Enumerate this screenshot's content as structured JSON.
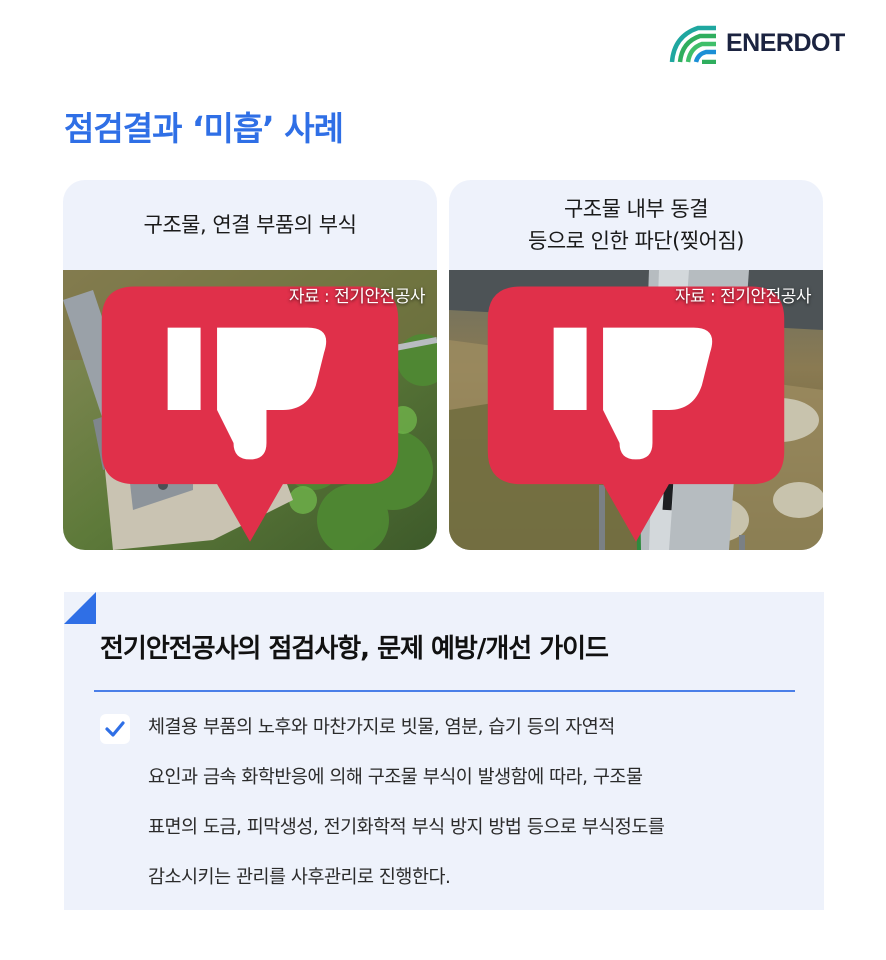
{
  "brand": {
    "name": "ENERDOT",
    "icon": "enerdot-wave-logo"
  },
  "page_title": "점검결과 ‘미흡’ 사례",
  "cards": [
    {
      "title": "구조물, 연결 부품의 부식",
      "badge_icon": "thumbs-down-icon",
      "source": "자료 : 전기안전공사",
      "photo": "corroded-turnbuckle-photo"
    },
    {
      "title": "구조물 내부 동결\n등으로 인한 파단(찢어짐)",
      "badge_icon": "thumbs-down-icon",
      "source": "자료 : 전기안전공사",
      "photo": "split-steel-post-photo"
    }
  ],
  "guide": {
    "title": "전기안전공사의 점검사항, 문제 예방/개선 가이드",
    "check_icon": "check-icon",
    "lines": [
      "체결용 부품의 노후와 마찬가지로 빗물, 염분, 습기 등의 자연적",
      "요인과 금속 화학반응에 의해 구조물 부식이 발생함에 따라, 구조물",
      "표면의 도금, 피막생성, 전기화학적 부식 방지 방법 등으로 부식정도를",
      "감소시키는 관리를 사후관리로 진행한다."
    ]
  },
  "colors": {
    "accent": "#2f6fe6",
    "panel": "#eef2fb",
    "badge": "#e0304a",
    "logo_green": "#2fae5e",
    "logo_navy": "#1b2340"
  }
}
